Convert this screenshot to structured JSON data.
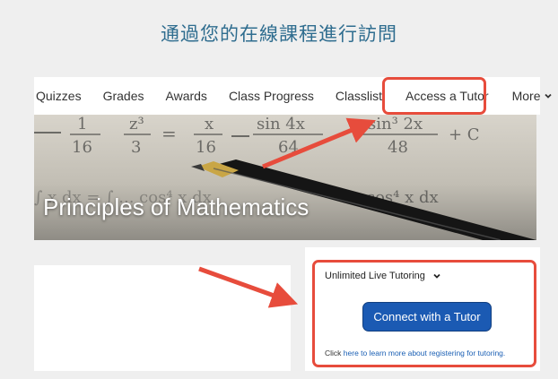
{
  "heading": "通過您的在線課程進行訪問",
  "nav": {
    "items": [
      "Quizzes",
      "Grades",
      "Awards",
      "Class Progress",
      "Classlist",
      "Access a Tutor"
    ],
    "more_label": "More"
  },
  "banner": {
    "course_title": "Principles of Mathematics",
    "formula_top": [
      "1",
      "16",
      "z³",
      "3",
      "x",
      "16",
      "sin 4x",
      "64",
      "sin³ 2x",
      "48",
      "+ C"
    ],
    "formula_bottom": "∫ x dx = ∫ ... cos⁴ x dx"
  },
  "tutoring": {
    "dropdown_label": "Unlimited Live Tutoring",
    "connect_button": "Connect with a Tutor",
    "help_prefix": "Click ",
    "help_link": "here to learn more about registering for tutoring.",
    "help_suffix": ""
  },
  "colors": {
    "highlight": "#e74c3c",
    "button": "#1b5ab3",
    "heading": "#2f6d8f"
  },
  "icons": [
    "chevron-down-icon",
    "arrow-icon"
  ]
}
